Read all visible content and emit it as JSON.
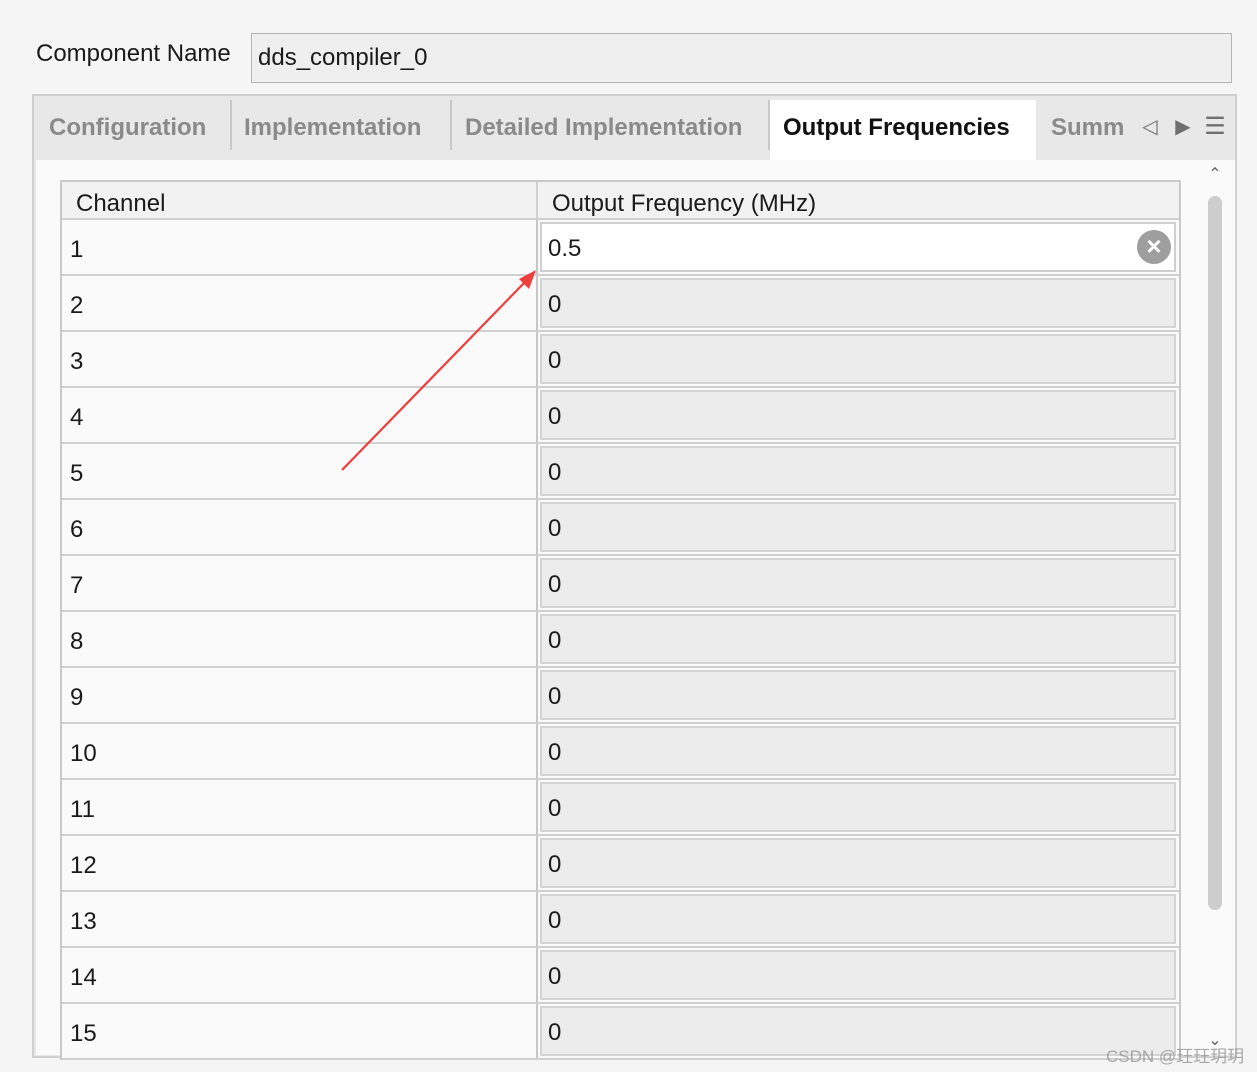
{
  "component_name": {
    "label": "Component Name",
    "value": "dds_compiler_0"
  },
  "tabs": [
    {
      "label": "Configuration",
      "active": false
    },
    {
      "label": "Implementation",
      "active": false
    },
    {
      "label": "Detailed Implementation",
      "active": false
    },
    {
      "label": "Output Frequencies",
      "active": true
    },
    {
      "label": "Summ",
      "active": false
    }
  ],
  "tab_nav": {
    "prev_icon": "◁",
    "next_icon": "▶",
    "menu_icon": "☰"
  },
  "table": {
    "headers": {
      "channel": "Channel",
      "frequency": "Output Frequency (MHz)"
    },
    "rows": [
      {
        "channel": "1",
        "frequency": "0.5",
        "editing": true
      },
      {
        "channel": "2",
        "frequency": "0"
      },
      {
        "channel": "3",
        "frequency": "0"
      },
      {
        "channel": "4",
        "frequency": "0"
      },
      {
        "channel": "5",
        "frequency": "0"
      },
      {
        "channel": "6",
        "frequency": "0"
      },
      {
        "channel": "7",
        "frequency": "0"
      },
      {
        "channel": "8",
        "frequency": "0"
      },
      {
        "channel": "9",
        "frequency": "0"
      },
      {
        "channel": "10",
        "frequency": "0"
      },
      {
        "channel": "11",
        "frequency": "0"
      },
      {
        "channel": "12",
        "frequency": "0"
      },
      {
        "channel": "13",
        "frequency": "0"
      },
      {
        "channel": "14",
        "frequency": "0"
      },
      {
        "channel": "15",
        "frequency": "0"
      }
    ]
  },
  "clear_icon": "×",
  "scroll": {
    "up_icon": "⌃",
    "down_icon": "⌄"
  },
  "annotation": {
    "color": "#f03c3c"
  },
  "watermark": "CSDN @玨玨玥玥"
}
